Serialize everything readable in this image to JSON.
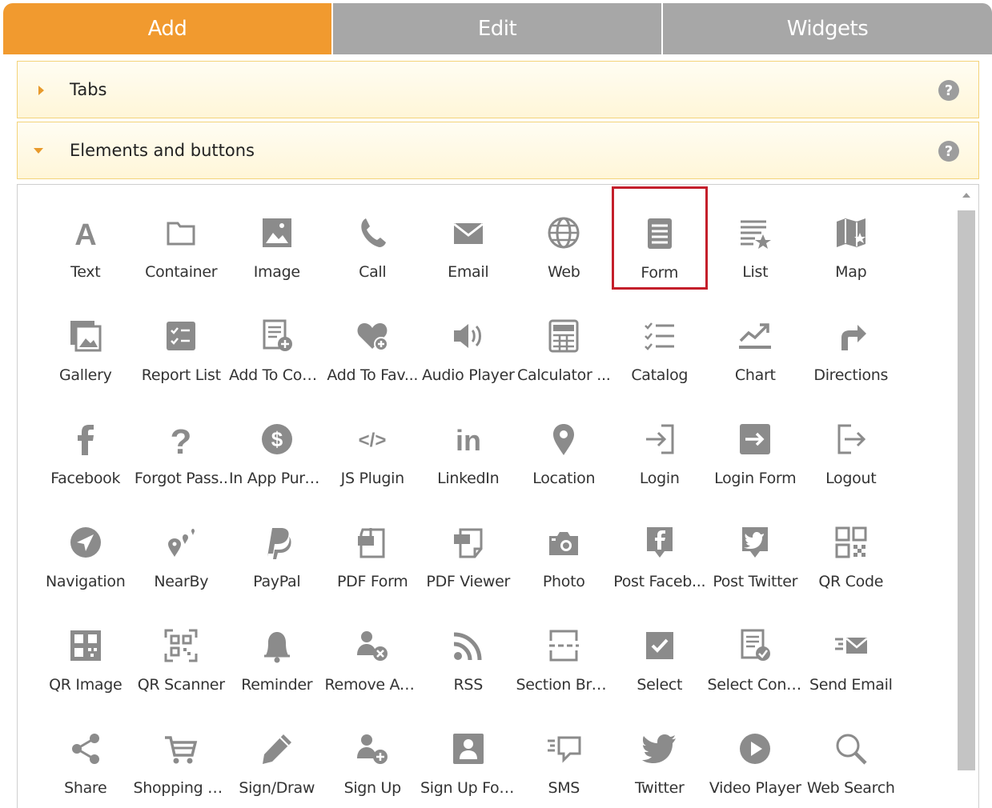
{
  "tabs": [
    {
      "label": "Add",
      "active": true
    },
    {
      "label": "Edit",
      "active": false
    },
    {
      "label": "Widgets",
      "active": false
    }
  ],
  "accordion": [
    {
      "title": "Tabs",
      "expanded": false
    },
    {
      "title": "Elements and buttons",
      "expanded": true
    }
  ],
  "help_symbol": "?",
  "colors": {
    "active_tab": "#f19a2f",
    "inactive_tab": "#a7a7a7",
    "icon": "#8b8b8b",
    "highlight_border": "#c41f2b"
  },
  "highlighted_item": "Form",
  "items": [
    [
      "Text",
      "Container",
      "Image",
      "Call",
      "Email",
      "Web",
      "Form",
      "List",
      "Map"
    ],
    [
      "Gallery",
      "Report List",
      "Add To Con...",
      "Add To Fav...",
      "Audio Player",
      "Calculator ...",
      "Catalog",
      "Chart",
      "Directions"
    ],
    [
      "Facebook",
      "Forgot Pass..",
      "In App Purc...",
      "JS Plugin",
      "LinkedIn",
      "Location",
      "Login",
      "Login Form",
      "Logout"
    ],
    [
      "Navigation",
      "NearBy",
      "PayPal",
      "PDF Form",
      "PDF Viewer",
      "Photo",
      "Post Faceb...",
      "Post Twitter",
      "QR Code"
    ],
    [
      "QR Image",
      "QR Scanner",
      "Reminder",
      "Remove Ac...",
      "RSS",
      "Section Bre...",
      "Select",
      "Select Cont...",
      "Send Email"
    ],
    [
      "Share",
      "Shopping C...",
      "Sign/Draw",
      "Sign Up",
      "Sign Up For...",
      "SMS",
      "Twitter",
      "Video Player",
      "Web Search"
    ]
  ],
  "icons": [
    [
      "text-icon",
      "container-icon",
      "image-icon",
      "call-icon",
      "email-icon",
      "web-icon",
      "form-icon",
      "list-icon",
      "map-icon"
    ],
    [
      "gallery-icon",
      "report-list-icon",
      "add-to-contacts-icon",
      "add-to-favorites-icon",
      "audio-player-icon",
      "calculator-icon",
      "catalog-icon",
      "chart-icon",
      "directions-icon"
    ],
    [
      "facebook-icon",
      "forgot-password-icon",
      "in-app-purchase-icon",
      "js-plugin-icon",
      "linkedin-icon",
      "location-icon",
      "login-icon",
      "login-form-icon",
      "logout-icon"
    ],
    [
      "navigation-icon",
      "nearby-icon",
      "paypal-icon",
      "pdf-form-icon",
      "pdf-viewer-icon",
      "photo-icon",
      "post-facebook-icon",
      "post-twitter-icon",
      "qr-code-icon"
    ],
    [
      "qr-image-icon",
      "qr-scanner-icon",
      "reminder-icon",
      "remove-account-icon",
      "rss-icon",
      "section-break-icon",
      "select-icon",
      "select-contact-icon",
      "send-email-icon"
    ],
    [
      "share-icon",
      "shopping-cart-icon",
      "sign-draw-icon",
      "sign-up-icon",
      "sign-up-form-icon",
      "sms-icon",
      "twitter-icon",
      "video-player-icon",
      "web-search-icon"
    ]
  ]
}
